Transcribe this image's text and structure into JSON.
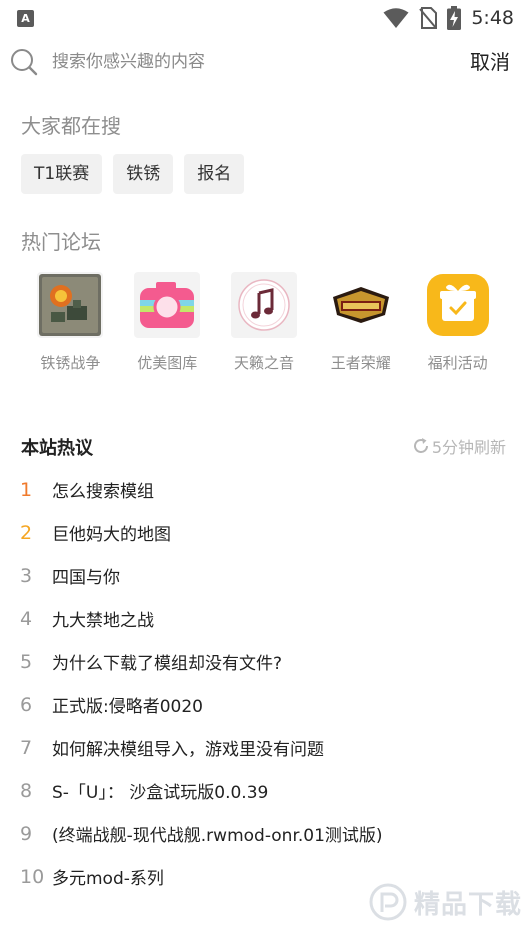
{
  "status_bar": {
    "app_glyph": "A",
    "time": "5:48",
    "icons": [
      "wifi-icon",
      "no-sim-icon",
      "battery-charging-icon"
    ]
  },
  "search": {
    "placeholder": "搜索你感兴趣的内容",
    "value": "",
    "cancel_label": "取消"
  },
  "hot_search": {
    "title": "大家都在搜",
    "tags": [
      "T1联赛",
      "铁锈",
      "报名"
    ]
  },
  "forums": {
    "title": "热门论坛",
    "items": [
      {
        "label": "铁锈战争",
        "icon": "rusted-warfare-icon"
      },
      {
        "label": "优美图库",
        "icon": "camera-icon"
      },
      {
        "label": "天籁之音",
        "icon": "music-note-icon"
      },
      {
        "label": "王者荣耀",
        "icon": "honor-of-kings-logo"
      },
      {
        "label": "福利活动",
        "icon": "gift-box-icon"
      }
    ]
  },
  "hot_topics": {
    "title": "本站热议",
    "refresh_label": "5分钟刷新",
    "items": [
      {
        "rank": "1",
        "text": "怎么搜索模组"
      },
      {
        "rank": "2",
        "text": "巨他妈大的地图"
      },
      {
        "rank": "3",
        "text": "四国与你"
      },
      {
        "rank": "4",
        "text": "九大禁地之战"
      },
      {
        "rank": "5",
        "text": "为什么下载了模组却没有文件?"
      },
      {
        "rank": "6",
        "text": "正式版:侵略者0020"
      },
      {
        "rank": "7",
        "text": "如何解决模组导入，游戏里没有问题"
      },
      {
        "rank": "8",
        "text": "S-「U」： 沙盒试玩版0.0.39"
      },
      {
        "rank": "9",
        "text": "(终端战舰-现代战舰.rwmod-onr.01测试版)"
      },
      {
        "rank": "10",
        "text": "多元mod-系列"
      }
    ]
  },
  "colors": {
    "rank_first": "#f07a2c",
    "rank_second": "#f5a623",
    "rank_default": "#9a9a9a",
    "tag_bg": "#f1f1f1"
  },
  "watermark": {
    "text": "精品下载"
  }
}
